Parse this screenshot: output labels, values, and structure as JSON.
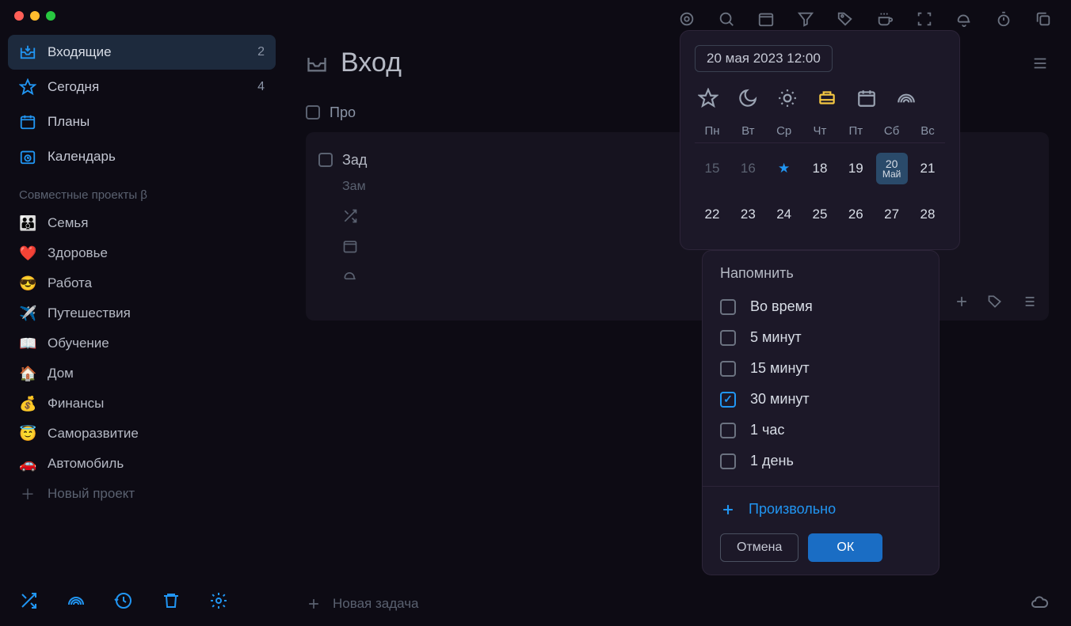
{
  "sidebar": {
    "nav": [
      {
        "label": "Входящие",
        "count": "2",
        "active": true
      },
      {
        "label": "Сегодня",
        "count": "4"
      },
      {
        "label": "Планы"
      },
      {
        "label": "Календарь"
      }
    ],
    "section_label": "Совместные проекты β",
    "projects": [
      {
        "emoji": "👪",
        "label": "Семья"
      },
      {
        "emoji": "❤️",
        "label": "Здоровье"
      },
      {
        "emoji": "😎",
        "label": "Работа"
      },
      {
        "emoji": "✈️",
        "label": "Путешествия"
      },
      {
        "emoji": "📖",
        "label": "Обучение"
      },
      {
        "emoji": "🏠",
        "label": "Дом"
      },
      {
        "emoji": "💰",
        "label": "Финансы"
      },
      {
        "emoji": "😇",
        "label": "Саморазвитие"
      },
      {
        "emoji": "🚗",
        "label": "Автомобиль"
      }
    ],
    "new_project": "Новый проект"
  },
  "main": {
    "title": "Вход",
    "task1": "Про",
    "task2": "Зад",
    "notes": "Зам",
    "new_task": "Новая задача"
  },
  "date_popup": {
    "chip": "20 мая 2023 12:00",
    "weekdays": [
      "Пн",
      "Вт",
      "Ср",
      "Чт",
      "Пт",
      "Сб",
      "Вс"
    ],
    "rows": [
      [
        "15",
        "16",
        "★",
        "18",
        "19",
        "20",
        "21"
      ],
      [
        "22",
        "23",
        "24",
        "25",
        "26",
        "27",
        "28"
      ]
    ],
    "selected_month": "Май"
  },
  "remind_popup": {
    "title": "Напомнить",
    "options": [
      {
        "label": "Во время",
        "checked": false
      },
      {
        "label": "5 минут",
        "checked": false
      },
      {
        "label": "15 минут",
        "checked": false
      },
      {
        "label": "30 минут",
        "checked": true
      },
      {
        "label": "1 час",
        "checked": false
      },
      {
        "label": "1 день",
        "checked": false
      }
    ],
    "custom": "Произвольно",
    "cancel": "Отмена",
    "ok": "ОК"
  }
}
